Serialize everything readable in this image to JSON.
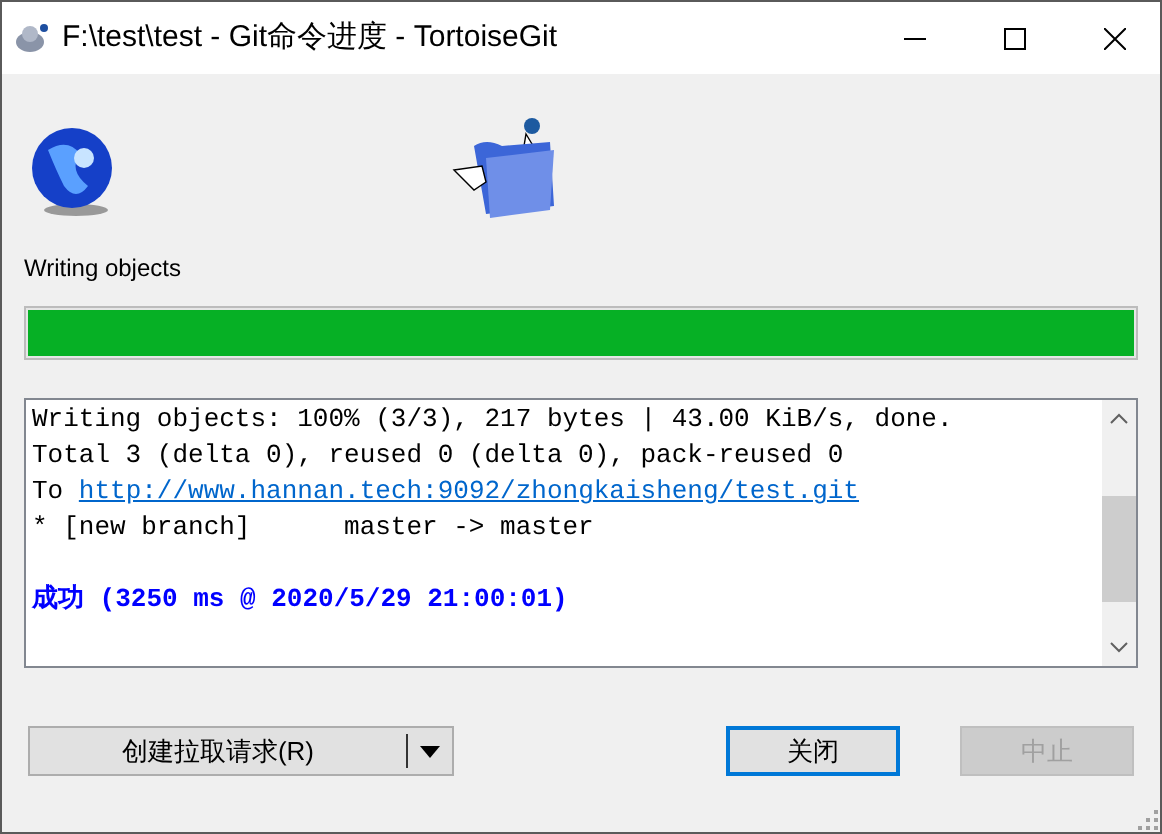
{
  "window": {
    "title": "F:\\test\\test - Git命令进度 - TortoiseGit"
  },
  "status_label": "Writing objects",
  "progress": {
    "level": 1.0
  },
  "log": [
    {
      "kind": "text",
      "text": "Writing objects: 100% (3/3), 217 bytes | 43.00 KiB/s, done."
    },
    {
      "kind": "text",
      "text": "Total 3 (delta 0), reused 0 (delta 0), pack-reused 0"
    },
    {
      "kind": "link",
      "prefix": "To",
      "link": "http://www.hannan.tech:9092/zhongkaisheng/test.git"
    },
    {
      "kind": "text",
      "text": "* [new branch]      master -> master"
    },
    {
      "kind": "success",
      "text": "成功 (3250 ms @ 2020/5/29 21:00:01)"
    }
  ],
  "buttons": [
    {
      "kind": "split",
      "label": "创建拉取请求(R)",
      "disabled": false,
      "default": false
    },
    {
      "kind": "plain",
      "label": "关闭",
      "disabled": false,
      "default": true
    },
    {
      "kind": "plain",
      "label": "中止",
      "disabled": true,
      "default": false
    }
  ]
}
